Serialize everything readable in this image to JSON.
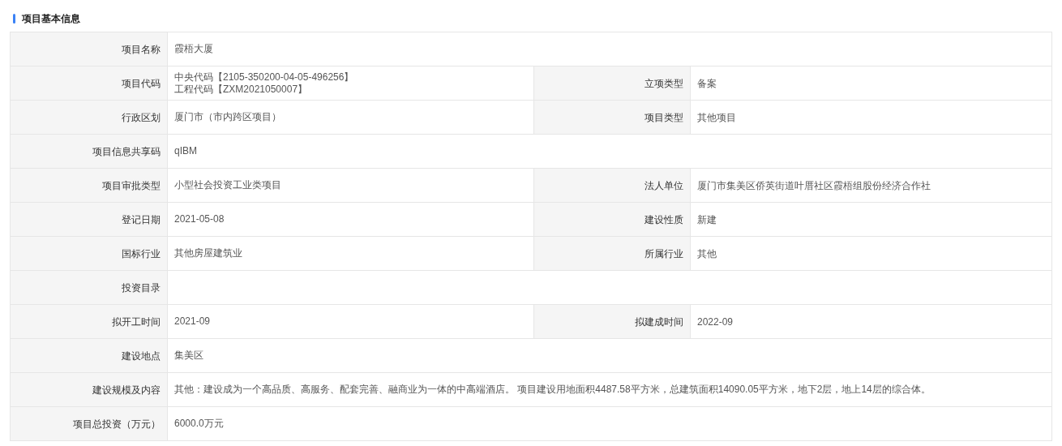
{
  "section": {
    "title": "项目基本信息"
  },
  "rows": [
    {
      "label": "项目名称",
      "value": [
        "霞梧大厦"
      ]
    },
    {
      "label": "项目代码",
      "value": [
        "中央代码【2105-350200-04-05-496256】",
        "工程代码【ZXM2021050007】"
      ],
      "right": {
        "label": "立项类型",
        "value": "备案"
      }
    },
    {
      "label": "行政区划",
      "value": [
        "厦门市（市内跨区项目）"
      ],
      "right": {
        "label": "项目类型",
        "value": "其他项目"
      }
    },
    {
      "label": "项目信息共享码",
      "value": [
        "qIBM"
      ]
    },
    {
      "label": "项目审批类型",
      "value": [
        "小型社会投资工业类项目"
      ],
      "right": {
        "label": "法人单位",
        "value": "厦门市集美区侨英街道叶厝社区霞梧组股份经济合作社"
      }
    },
    {
      "label": "登记日期",
      "value": [
        "2021-05-08"
      ],
      "right": {
        "label": "建设性质",
        "value": "新建"
      }
    },
    {
      "label": "国标行业",
      "value": [
        "其他房屋建筑业"
      ],
      "right": {
        "label": "所属行业",
        "value": "其他"
      }
    },
    {
      "label": "投资目录",
      "value": []
    },
    {
      "label": "拟开工时间",
      "value": [
        "2021-09"
      ],
      "right": {
        "label": "拟建成时间",
        "value": "2022-09"
      }
    },
    {
      "label": "建设地点",
      "value": [
        "集美区"
      ]
    },
    {
      "label": "建设规模及内容",
      "value": [
        "其他：建设成为一个高品质、高服务、配套完善、融商业为一体的中高端酒店。 项目建设用地面积4487.58平方米，总建筑面积14090.05平方米，地下2层，地上14层的综合体。"
      ]
    },
    {
      "label": "项目总投资（万元）",
      "value": [
        "6000.0万元"
      ]
    }
  ]
}
